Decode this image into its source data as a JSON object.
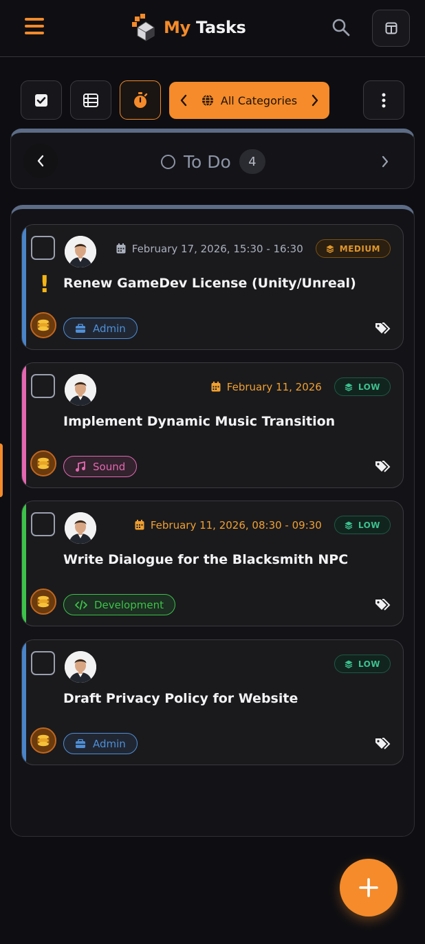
{
  "app": {
    "title_part1": "My",
    "title_part2": "Tasks",
    "accent_color": "#f58b2a"
  },
  "header": {
    "menu_icon": "hamburger-menu-icon",
    "search_icon": "search-icon",
    "layout_icon": "columns-layout-icon"
  },
  "toolbar": {
    "view_buttons": [
      {
        "icon": "checkbox-icon",
        "active": false
      },
      {
        "icon": "list-icon",
        "active": false
      },
      {
        "icon": "stopwatch-icon",
        "active": true
      }
    ],
    "category_filter": {
      "label": "All Categories",
      "icon": "globe-icon"
    },
    "more_icon": "kebab-menu-icon"
  },
  "status": {
    "label": "To Do",
    "count": "4",
    "border_color": "#5d6c86"
  },
  "tasks": [
    {
      "title": "Renew GameDev License (Unity/Unreal)",
      "date": "February 17, 2026, 15:30 - 16:30",
      "date_color": "#aab0bd",
      "priority": "MEDIUM",
      "category": "Admin",
      "category_color": "#4f8fd6",
      "accent_color": "#4a84c9",
      "important": true
    },
    {
      "title": "Implement Dynamic Music Transition",
      "date": "February 11, 2026",
      "date_color": "#f0a030",
      "priority": "LOW",
      "category": "Sound",
      "category_color": "#e467b0",
      "accent_color": "#e467b0",
      "important": false
    },
    {
      "title": "Write Dialogue for the Blacksmith NPC",
      "date": "February 11, 2026, 08:30 - 09:30",
      "date_color": "#f0a030",
      "priority": "LOW",
      "category": "Development",
      "category_color": "#3dc24a",
      "accent_color": "#3dc24a",
      "important": false
    },
    {
      "title": "Draft Privacy Policy for Website",
      "date": "",
      "date_color": "#aab0bd",
      "priority": "LOW",
      "category": "Admin",
      "category_color": "#4f8fd6",
      "accent_color": "#4a84c9",
      "important": false
    }
  ],
  "fab": {
    "icon": "plus-icon"
  }
}
